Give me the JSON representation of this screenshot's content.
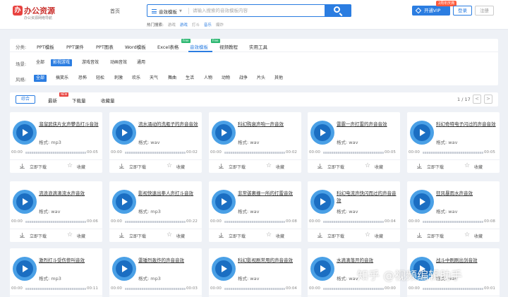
{
  "header": {
    "logo_name": "办公资源",
    "logo_slogan": "办公资源网络导航",
    "nav_home": "首页",
    "search_type": "音效模板",
    "search_placeholder": "请输入搜索的音效模板内容",
    "hot_label": "热门搜索:",
    "hot_words": [
      "游戏",
      "游戏",
      "打斗",
      "音乐",
      "爆炸"
    ],
    "vip_label": "开通VIP",
    "vip_tag": "2周年庆典",
    "login_label": "登录",
    "register_label": "注册"
  },
  "filters": {
    "category_label": "分类:",
    "categories": [
      {
        "label": "PPT模板"
      },
      {
        "label": "PPT课件"
      },
      {
        "label": "PPT图表"
      },
      {
        "label": "Word模板"
      },
      {
        "label": "Excel表格",
        "badge": "Free"
      },
      {
        "label": "音效模板",
        "badge": "Free"
      },
      {
        "label": "视频教程"
      },
      {
        "label": "实用工具"
      }
    ],
    "scene_label": "场景:",
    "scenes": [
      "全部",
      "影视游戏",
      "游戏音效",
      "动画音效",
      "通用"
    ],
    "style_label": "风格:",
    "styles": [
      "全部",
      "搞笑乐",
      "恐怖",
      "轻松",
      "刺激",
      "欢乐",
      "天气",
      "舞曲",
      "生活",
      "人物",
      "动物",
      "战争",
      "片头",
      "其他"
    ]
  },
  "sort": {
    "items": [
      "综合",
      "最新",
      "下载量",
      "收藏量"
    ],
    "new_badge": "NEW",
    "page_info": "1 / 17",
    "prev": "<",
    "next": ">"
  },
  "card_labels": {
    "format_prefix": "格式:",
    "time_start": "00:00",
    "download": "立即下载",
    "favorite": "收藏"
  },
  "cards": [
    {
      "title": "溜溜武侠片女声攀击打斗音效",
      "format": "mp3",
      "duration": "00:05"
    },
    {
      "title": "流水涌动的洗瓶子的声音音效",
      "format": "wav",
      "duration": "00:02"
    },
    {
      "title": "科幻购衰声响一声音效",
      "format": "wav",
      "duration": "00:02"
    },
    {
      "title": "雷霆一声打雷的声音音效",
      "format": "wav",
      "duration": "00:05"
    },
    {
      "title": "科幻奇特电子闪过的声音音效",
      "format": "wav",
      "duration": "00:05"
    },
    {
      "title": "流浪浪滴滴流水声音效",
      "format": "wav",
      "duration": "00:06"
    },
    {
      "title": "影视快速出拳人声打斗音效",
      "format": "mp3",
      "duration": "00:22"
    },
    {
      "title": "非常骇裹撞一所的打雷音效",
      "format": "wav",
      "duration": "00:08"
    },
    {
      "title": "科幻电流声快闪而过的声音音效",
      "format": "wav",
      "duration": "00:04"
    },
    {
      "title": "狂风暴雨水声音效",
      "format": "wav",
      "duration": "00:08"
    },
    {
      "title": "激烈打斗受伤惨叫音效",
      "format": "mp3",
      "duration": "00:11"
    },
    {
      "title": "雷锤烈轰炸的声音音效",
      "format": "mp3",
      "duration": "00:03"
    },
    {
      "title": "科幻影视剧常用的声音音效",
      "format": "wav",
      "duration": "00:04"
    },
    {
      "title": "水滴滴落开的音效",
      "format": "wav",
      "duration": "00:00"
    },
    {
      "title": "战斗中刷刷出剑音效",
      "format": "wav",
      "duration": "00:01"
    }
  ],
  "watermark": "知乎 @视频编辑助手"
}
